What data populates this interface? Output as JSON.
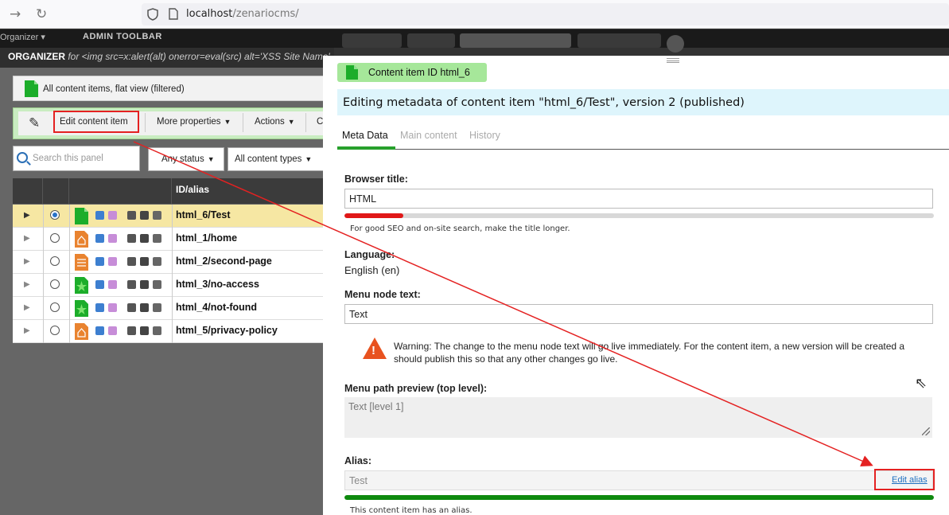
{
  "browser": {
    "back_glyph": "→",
    "reload_glyph": "↻",
    "url_host": "localhost",
    "url_path": "/zenariocms/"
  },
  "admin_toolbar": {
    "organizer_menu": "Organizer ▾",
    "title": "ADMIN TOOLBAR"
  },
  "organizer": {
    "title_bold": "ORGANIZER",
    "title_rest": " for <img src=x:alert(alt) onerror=eval(src) alt='XSS Site Name'",
    "filter_label": "All content items, flat view (filtered)",
    "toolbar": {
      "edit": "Edit content item",
      "more": "More properties",
      "actions": "Actions",
      "cut": "C"
    },
    "search_placeholder": "Search this panel",
    "status_filter": "Any status",
    "type_filter": "All content types",
    "column_header": "ID/alias",
    "rows": [
      {
        "alias": "html_6/Test",
        "icon": "green-doc-icon",
        "selected": true
      },
      {
        "alias": "html_1/home",
        "icon": "orange-home-icon",
        "selected": false
      },
      {
        "alias": "html_2/second-page",
        "icon": "orange-doc-icon",
        "selected": false
      },
      {
        "alias": "html_3/no-access",
        "icon": "green-star-icon",
        "selected": false
      },
      {
        "alias": "html_4/not-found",
        "icon": "green-star-icon",
        "selected": false
      },
      {
        "alias": "html_5/privacy-policy",
        "icon": "orange-home-icon",
        "selected": false
      }
    ]
  },
  "editor": {
    "badge": "Content item ID   html_6",
    "headline": "Editing metadata of content item \"html_6/Test\", version 2 (published)",
    "tabs": [
      "Meta Data",
      "Main content",
      "History"
    ],
    "browser_title_label": "Browser title:",
    "browser_title_value": "HTML",
    "title_score": 0.1,
    "title_note": "For good SEO and on-site search, make the title longer.",
    "language_label": "Language:",
    "language_value": "English (en)",
    "menu_text_label": "Menu node text:",
    "menu_text_value": "Text",
    "warning_line1": "Warning: The change to the menu node text will go live immediately. For the content item, a new version will be created a",
    "warning_line2": "should publish this so that any other changes go live.",
    "path_label": "Menu path preview (top level):",
    "path_value": "Text [level 1]",
    "alias_label": "Alias:",
    "alias_value": "Test",
    "edit_alias": "Edit alias",
    "alias_score": 1.0,
    "alias_note": "This content item has an alias."
  },
  "colors": {
    "highlight": "#e42121",
    "meter_bad": "#e01818",
    "meter_good": "#0e8a0e"
  }
}
